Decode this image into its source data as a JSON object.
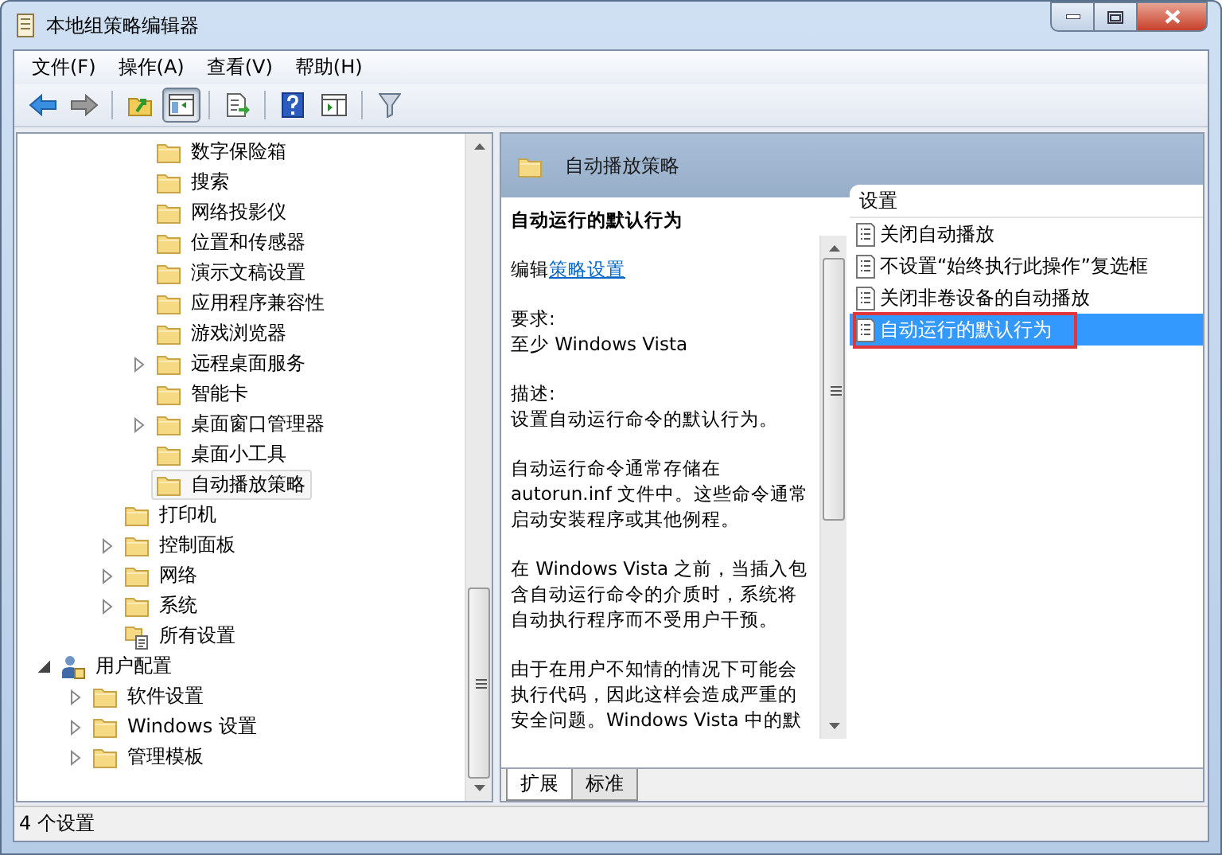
{
  "window": {
    "title": "本地组策略编辑器"
  },
  "menu": [
    "文件(F)",
    "操作(A)",
    "查看(V)",
    "帮助(H)"
  ],
  "toolbar": [
    {
      "kind": "back",
      "pressed": false
    },
    {
      "kind": "forward",
      "pressed": false
    },
    {
      "kind": "separator"
    },
    {
      "kind": "up",
      "pressed": false
    },
    {
      "kind": "tree",
      "pressed": true
    },
    {
      "kind": "separator"
    },
    {
      "kind": "export",
      "pressed": false
    },
    {
      "kind": "separator"
    },
    {
      "kind": "help",
      "pressed": false
    },
    {
      "kind": "pane",
      "pressed": false
    },
    {
      "kind": "separator"
    },
    {
      "kind": "filter",
      "pressed": false
    }
  ],
  "tree": {
    "items": [
      {
        "children": [
          {
            "children": [
              {
                "children": [
                  {
                    "label": "数字保险箱",
                    "kind": "folder",
                    "expandable": false,
                    "selected": false
                  },
                  {
                    "label": "搜索",
                    "kind": "folder",
                    "expandable": false,
                    "selected": false
                  },
                  {
                    "label": "网络投影仪",
                    "kind": "folder",
                    "expandable": false,
                    "selected": false
                  },
                  {
                    "label": "位置和传感器",
                    "kind": "folder",
                    "expandable": false,
                    "selected": false
                  },
                  {
                    "label": "演示文稿设置",
                    "kind": "folder",
                    "expandable": false,
                    "selected": false
                  },
                  {
                    "label": "应用程序兼容性",
                    "kind": "folder",
                    "expandable": false,
                    "selected": false
                  },
                  {
                    "label": "游戏浏览器",
                    "kind": "folder",
                    "expandable": false,
                    "selected": false
                  },
                  {
                    "label": "远程桌面服务",
                    "kind": "folder",
                    "expandable": true,
                    "expanded": false,
                    "selected": false
                  },
                  {
                    "label": "智能卡",
                    "kind": "folder",
                    "expandable": false,
                    "selected": false
                  },
                  {
                    "label": "桌面窗口管理器",
                    "kind": "folder",
                    "expandable": true,
                    "expanded": false,
                    "selected": false
                  },
                  {
                    "label": "桌面小工具",
                    "kind": "folder",
                    "expandable": false,
                    "selected": false
                  },
                  {
                    "label": "自动播放策略",
                    "kind": "folder",
                    "expandable": false,
                    "selected": true
                  }
                ]
              },
              {
                "label": "打印机",
                "kind": "folder",
                "expandable": false,
                "selected": false
              },
              {
                "label": "控制面板",
                "kind": "folder",
                "expandable": true,
                "expanded": false,
                "selected": false
              },
              {
                "label": "网络",
                "kind": "folder",
                "expandable": true,
                "expanded": false,
                "selected": false
              },
              {
                "label": "系统",
                "kind": "folder",
                "expandable": true,
                "expanded": false,
                "selected": false
              },
              {
                "label": "所有设置",
                "kind": "settings",
                "expandable": false,
                "selected": false
              }
            ]
          }
        ]
      },
      {
        "label": "用户配置",
        "kind": "user",
        "expandable": true,
        "expanded": true,
        "selected": false,
        "children": [
          {
            "label": "软件设置",
            "kind": "folder",
            "expandable": true,
            "expanded": false,
            "selected": false
          },
          {
            "label": "Windows 设置",
            "kind": "folder",
            "expandable": true,
            "expanded": false,
            "selected": false
          },
          {
            "label": "管理模板",
            "kind": "folder",
            "expandable": true,
            "expanded": false,
            "selected": false
          }
        ]
      }
    ]
  },
  "details": {
    "header": "自动播放策略",
    "description": {
      "title": "自动运行的默认行为",
      "edit_prefix": "编辑",
      "edit_link": "策略设置",
      "sections": [
        {
          "heading": "要求:",
          "text": "至少 Windows Vista"
        },
        {
          "heading": "描述:",
          "text": "设置自动运行命令的默认行为。"
        }
      ],
      "paragraphs": [
        "自动运行命令通常存储在 autorun.inf 文件中。这些命令通常启动安装程序或其他例程。",
        "在 Windows Vista 之前，当插入包含自动运行命令的介质时，系统将自动执行程序而不受用户干预。",
        "由于在用户不知情的情况下可能会执行代码，因此这样会造成严重的安全问题。Windows Vista 中的默"
      ]
    },
    "list": {
      "column": "设置",
      "items": [
        {
          "label": "关闭自动播放",
          "selected": false,
          "highlighted": false
        },
        {
          "label": "不设置“始终执行此操作”复选框",
          "selected": false,
          "highlighted": false
        },
        {
          "label": "关闭非卷设备的自动播放",
          "selected": false,
          "highlighted": false
        },
        {
          "label": "自动运行的默认行为",
          "selected": true,
          "highlighted": true
        }
      ]
    },
    "tabs": [
      {
        "label": "扩展",
        "selected": true
      },
      {
        "label": "标准",
        "selected": false
      }
    ]
  },
  "status_bar": "4 个设置"
}
